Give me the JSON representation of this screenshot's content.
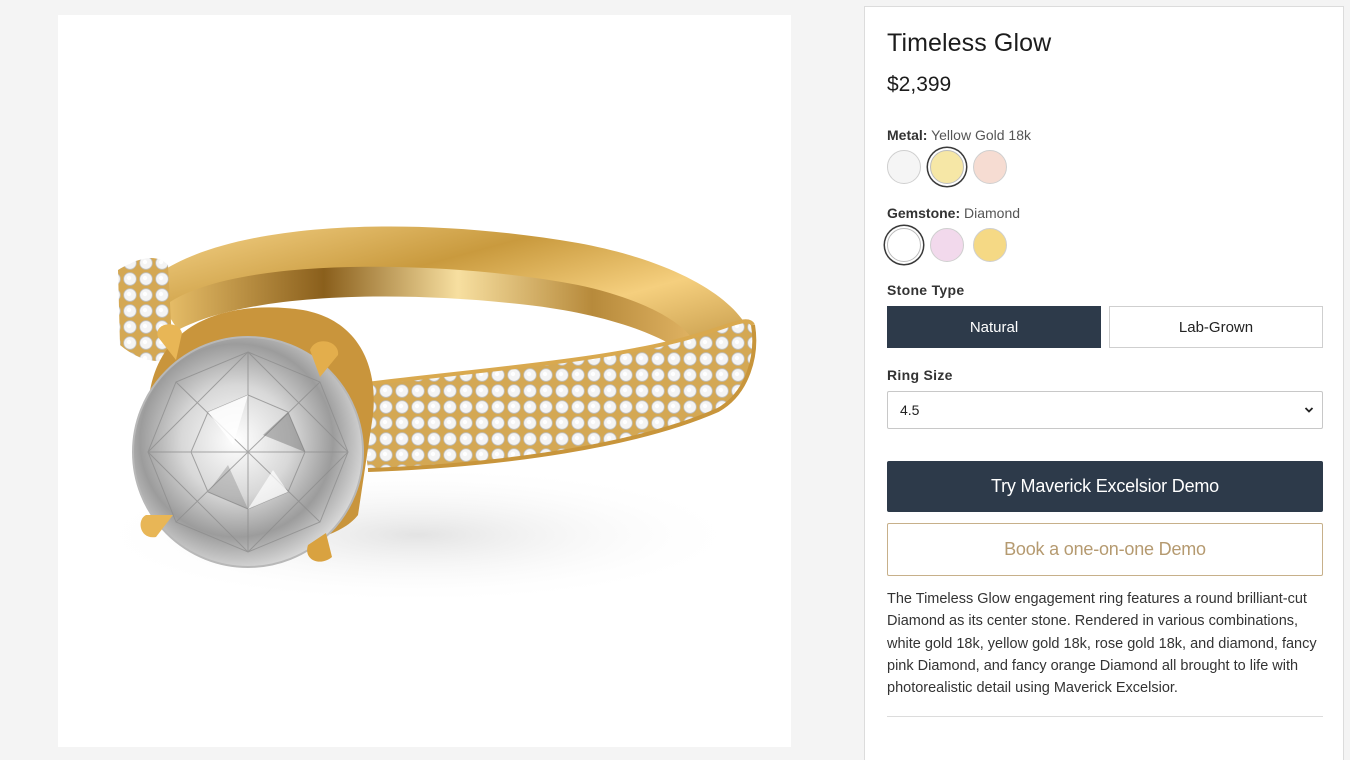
{
  "product": {
    "title": "Timeless Glow",
    "price": "$2,399",
    "image_alt_icon": "ring-product-image"
  },
  "metal": {
    "label": "Metal:",
    "selected_value": "Yellow Gold 18k",
    "swatches": [
      {
        "name": "white-gold",
        "color": "#f5f5f5",
        "selected": false
      },
      {
        "name": "yellow-gold",
        "color": "#f6e7a6",
        "selected": true
      },
      {
        "name": "rose-gold",
        "color": "#f6dcd2",
        "selected": false
      }
    ]
  },
  "gemstone": {
    "label": "Gemstone:",
    "selected_value": "Diamond",
    "swatches": [
      {
        "name": "diamond",
        "color": "#ffffff",
        "selected": true
      },
      {
        "name": "pink-diamond",
        "color": "#f2d9ec",
        "selected": false
      },
      {
        "name": "orange-diamond",
        "color": "#f5d985",
        "selected": false
      }
    ]
  },
  "stone_type": {
    "label": "Stone Type",
    "options": [
      "Natural",
      "Lab-Grown"
    ],
    "selected": "Natural"
  },
  "ring_size": {
    "label": "Ring Size",
    "value": "4.5"
  },
  "actions": {
    "primary": "Try Maverick Excelsior Demo",
    "secondary": "Book a one-on-one Demo"
  },
  "description": "The Timeless Glow engagement ring features a round brilliant-cut Diamond as its center stone. Rendered in various combinations, white gold 18k, yellow gold 18k, rose gold 18k, and diamond, fancy pink Diamond, and fancy orange Diamond all brought to life with photorealistic detail using Maverick Excelsior.",
  "colors": {
    "dark_navy": "#2d3a4a",
    "gold_accent": "#b59a70"
  }
}
